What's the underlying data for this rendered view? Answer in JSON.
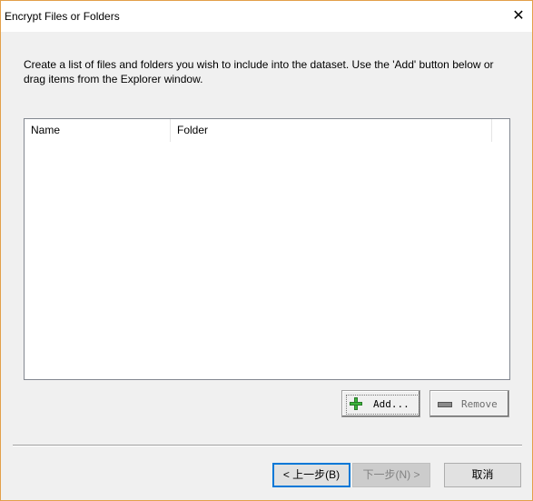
{
  "window": {
    "title": "Encrypt Files or Folders",
    "close_icon": "close-icon"
  },
  "instruction": "Create a list of files and folders you wish to include into the dataset. Use the 'Add' button below or drag items from the Explorer window.",
  "list": {
    "columns": [
      "Name",
      "Folder"
    ],
    "rows": []
  },
  "buttons": {
    "add": "Add...",
    "remove": "Remove",
    "back": "< 上一步(B)",
    "next": "下一步(N) >",
    "cancel": "取消"
  },
  "colors": {
    "focus": "#0078d7",
    "add_icon": "#3cb43c",
    "border": "#e3a04a"
  }
}
